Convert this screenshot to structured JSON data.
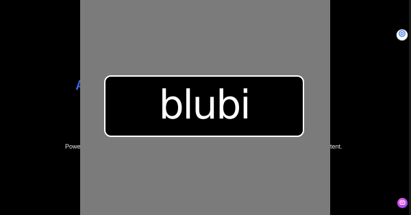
{
  "background": {
    "partial_heading": "A",
    "partial_text_left": "Power",
    "partial_text_right": "tent."
  },
  "splash": {
    "logo_text": "blubi"
  },
  "floating_buttons": {
    "top_icon": "assistant-icon",
    "bottom_icon": "chat-icon"
  },
  "colors": {
    "page_background": "#000000",
    "overlay": "#7b7b7b",
    "logo_card": "#000000",
    "logo_border": "#ffffff",
    "accent_blue": "#3b63d8"
  }
}
